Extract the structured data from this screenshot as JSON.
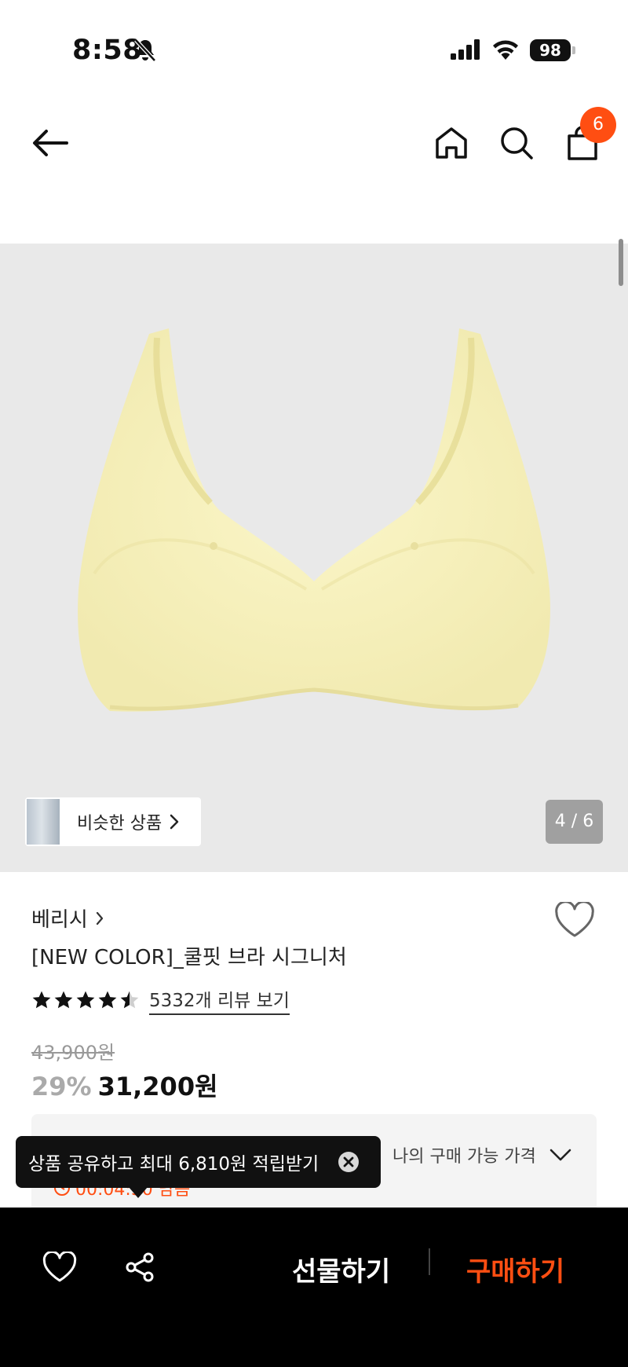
{
  "status_bar": {
    "time": "8:58",
    "battery": "98"
  },
  "header": {
    "cart_count": "6"
  },
  "product": {
    "similar_label": "비슷한 상품",
    "image_counter": "4 / 6",
    "brand": "베리시",
    "title": "[NEW COLOR]_쿨핏 브라 시그니처",
    "rating": 4.5,
    "review_link": "5332개 리뷰 보기",
    "original_price": "43,900원",
    "discount_percent": "29%",
    "sale_price": "31,200원",
    "my_price_label": "나의 구매 가능 가격",
    "timer_text": "00:04:50 남음"
  },
  "tooltip": {
    "text": "상품 공유하고 최대 6,810원 적립받기"
  },
  "bottom_bar": {
    "gift_label": "선물하기",
    "buy_label": "구매하기"
  },
  "colors": {
    "accent": "#ff4e12",
    "image_bg": "#e9e9e9",
    "product": "#f5f0b8"
  },
  "icons": [
    "back-arrow-icon",
    "home-icon",
    "search-icon",
    "shopping-bag-icon",
    "heart-icon",
    "share-icon",
    "close-icon",
    "chevron-right-icon",
    "chevron-down-icon",
    "star-icon",
    "clock-icon",
    "bell-slash-icon",
    "signal-icon",
    "wifi-icon"
  ]
}
